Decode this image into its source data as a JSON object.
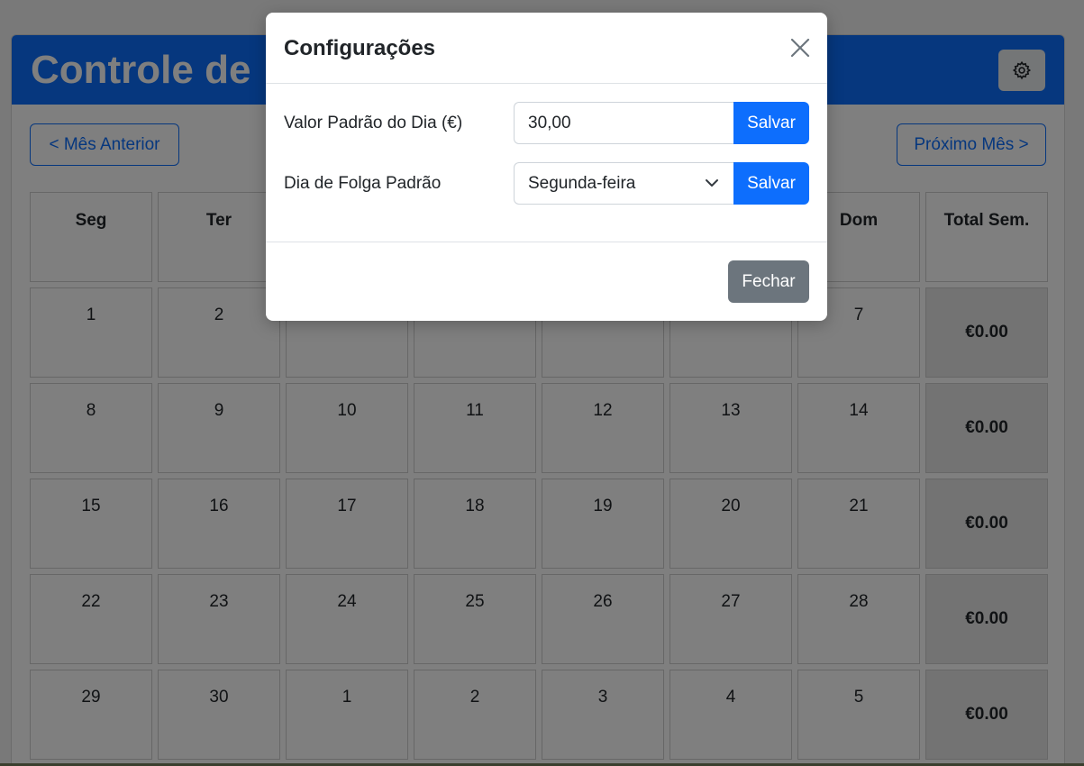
{
  "app": {
    "title": "Controle de",
    "settings_icon": "gear-icon",
    "prev_month_label": "< Mês Anterior",
    "next_month_label": "Próximo Mês >"
  },
  "calendar": {
    "headers": [
      "Seg",
      "Ter",
      "",
      "",
      "",
      "",
      "Dom",
      "Total Sem."
    ],
    "weeks": [
      {
        "days": [
          "1",
          "2",
          "",
          "",
          "",
          "",
          "7"
        ],
        "total": "€0.00"
      },
      {
        "days": [
          "8",
          "9",
          "10",
          "11",
          "12",
          "13",
          "14"
        ],
        "total": "€0.00"
      },
      {
        "days": [
          "15",
          "16",
          "17",
          "18",
          "19",
          "20",
          "21"
        ],
        "total": "€0.00"
      },
      {
        "days": [
          "22",
          "23",
          "24",
          "25",
          "26",
          "27",
          "28"
        ],
        "total": "€0.00"
      },
      {
        "days": [
          "29",
          "30",
          "1",
          "2",
          "3",
          "4",
          "5"
        ],
        "total": "€0.00"
      }
    ]
  },
  "modal": {
    "title": "Configurações",
    "close_icon": "close-icon",
    "daily_value_label": "Valor Padrão do Dia (€)",
    "daily_value": "30,00",
    "save_label": "Salvar",
    "day_off_label": "Dia de Folga Padrão",
    "day_off_value": "Segunda-feira",
    "close_label": "Fechar"
  },
  "colors": {
    "primary": "#0d6efd",
    "secondary": "#6c757d"
  }
}
